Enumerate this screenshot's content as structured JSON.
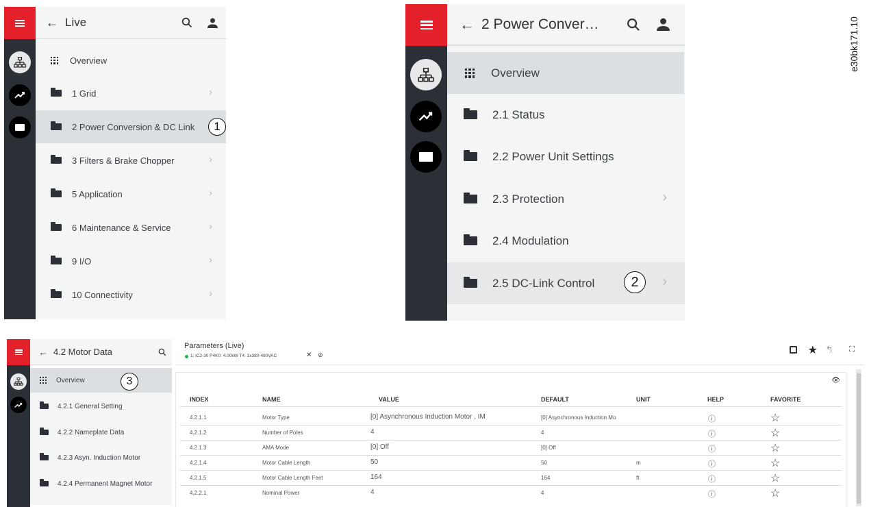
{
  "figure_id": "e30bk171.10",
  "colors": {
    "accent": "#e4202a",
    "rail": "#2a3036",
    "panel": "#f4f5f5",
    "selected": "#dcdfe1"
  },
  "panel_a": {
    "title": "Live",
    "rail_icons": [
      "network-icon",
      "trend-icon",
      "folder-icon"
    ],
    "items": [
      {
        "label": "Overview",
        "icon": "grid-icon",
        "chevron": false
      },
      {
        "label": "1 Grid",
        "icon": "folder-icon",
        "chevron": true
      },
      {
        "label": "2 Power Conversion & DC Link",
        "icon": "folder-icon",
        "chevron": false,
        "selected": true
      },
      {
        "label": "3 Filters & Brake Chopper",
        "icon": "folder-icon",
        "chevron": true
      },
      {
        "label": "5 Application",
        "icon": "folder-icon",
        "chevron": true
      },
      {
        "label": "6 Maintenance & Service",
        "icon": "folder-icon",
        "chevron": true
      },
      {
        "label": "9 I/O",
        "icon": "folder-icon",
        "chevron": true
      },
      {
        "label": "10 Connectivity",
        "icon": "folder-icon",
        "chevron": true
      }
    ],
    "callout": "1"
  },
  "panel_b": {
    "title": "2 Power Conver…",
    "rail_icons": [
      "network-icon",
      "trend-icon",
      "folder-icon"
    ],
    "items": [
      {
        "label": "Overview",
        "icon": "grid-icon",
        "chevron": false,
        "selected": true
      },
      {
        "label": "2.1 Status",
        "icon": "folder-icon",
        "chevron": false
      },
      {
        "label": "2.2 Power Unit Settings",
        "icon": "folder-icon",
        "chevron": false
      },
      {
        "label": "2.3 Protection",
        "icon": "folder-icon",
        "chevron": true
      },
      {
        "label": "2.4 Modulation",
        "icon": "folder-icon",
        "chevron": false
      },
      {
        "label": "2.5 DC-Link Control",
        "icon": "folder-icon",
        "chevron": true,
        "hover": true
      }
    ],
    "callout": "2"
  },
  "panel_c": {
    "title": "4.2 Motor Data",
    "rail_icons": [
      "network-icon",
      "trend-icon"
    ],
    "items": [
      {
        "label": "Overview",
        "icon": "grid-icon",
        "selected": true
      },
      {
        "label": "4.2.1 General Setting",
        "icon": "folder-icon"
      },
      {
        "label": "4.2.2 Nameplate Data",
        "icon": "folder-icon"
      },
      {
        "label": "4.2.3 Asyn. Induction Motor",
        "icon": "folder-icon"
      },
      {
        "label": "4.2.4 Permanent Magnet Motor",
        "icon": "folder-icon"
      }
    ],
    "callout": "3",
    "params_title": "Parameters (Live)",
    "device_info": "1; iC2-30 P4K0: 4.00kW T4: 3x380-480VAC",
    "status_color": "#27b24a",
    "columns": [
      "INDEX",
      "NAME",
      "VALUE",
      "DEFAULT",
      "UNIT",
      "HELP",
      "FAVORITE"
    ],
    "rows": [
      {
        "index": "4.2.1.1",
        "name": "Motor Type",
        "value": "[0] Asynchronous Induction Motor , IM",
        "default": "[0] Asynchronous Induction Mo",
        "unit": ""
      },
      {
        "index": "4.2.1.2",
        "name": "Number of Poles",
        "value": "4",
        "default": "4",
        "unit": ""
      },
      {
        "index": "4.2.1.3",
        "name": "AMA Mode",
        "value": "[0] Off",
        "default": "[0] Off",
        "unit": ""
      },
      {
        "index": "4.2.1.4",
        "name": "Motor Cable Length",
        "value": "50",
        "default": "50",
        "unit": "m"
      },
      {
        "index": "4.2.1.5",
        "name": "Motor Cable Length Feet",
        "value": "164",
        "default": "164",
        "unit": "ft"
      },
      {
        "index": "4.2.2.1",
        "name": "Nominal Power",
        "value": "4",
        "default": "4",
        "unit": ""
      }
    ]
  }
}
